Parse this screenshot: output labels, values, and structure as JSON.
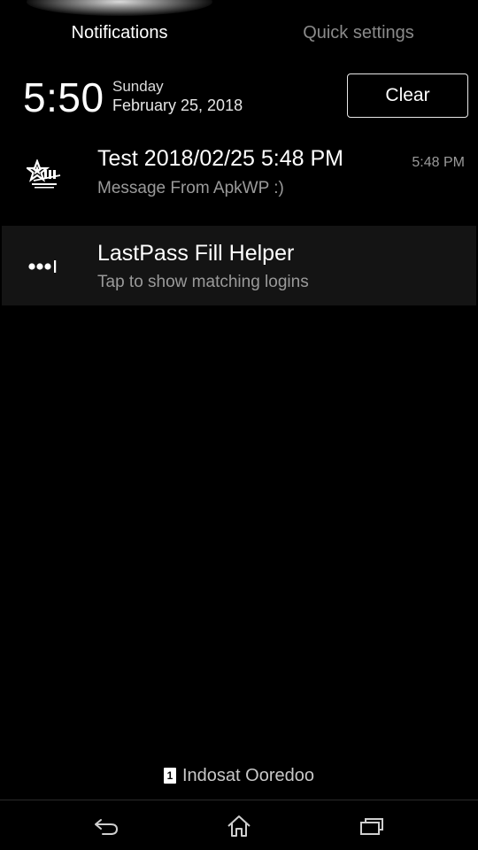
{
  "tabs": [
    {
      "label": "Notifications",
      "active": true
    },
    {
      "label": "Quick settings",
      "active": false
    }
  ],
  "clock": {
    "time": "5:50",
    "day": "Sunday",
    "date": "February 25, 2018"
  },
  "clear_button": {
    "label": "Clear"
  },
  "notifications": [
    {
      "icon": "star-app-icon",
      "title": "Test 2018/02/25 5:48 PM",
      "text": "Message From ApkWP :)",
      "time": "5:48 PM"
    },
    {
      "icon": "password-dots-icon",
      "title": "LastPass Fill Helper",
      "text": "Tap to show matching logins"
    }
  ],
  "carrier": {
    "sim": "1",
    "name": "Indosat Ooredoo"
  },
  "navbar": {
    "back_icon": "back-icon",
    "home_icon": "home-icon",
    "recents_icon": "recents-icon"
  },
  "colors": {
    "background": "#000000",
    "secondary_text": "#9a9a9a",
    "highlight_row": "#141414"
  }
}
